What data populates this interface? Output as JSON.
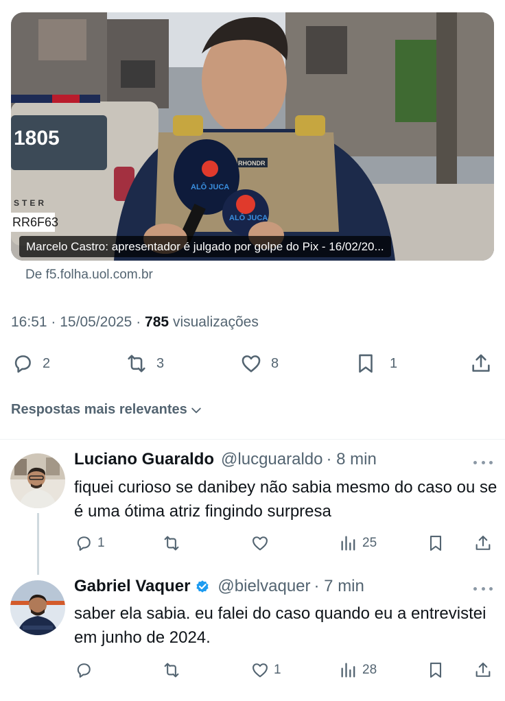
{
  "media": {
    "caption": "Marcelo Castro: apresentador é julgado por golpe do Pix - 16/02/20...",
    "vehicle_number": "1805",
    "vehicle_text": "STER",
    "plate": "RR6F63",
    "mic_label": "ALÔ JUCA",
    "vest_label": "RHONDR",
    "source": "De f5.folha.uol.com.br"
  },
  "tweet_meta": {
    "time": "16:51",
    "date": "15/05/2025",
    "sep": "·",
    "views_count": "785",
    "views_label": "visualizações"
  },
  "tweet_actions": {
    "replies": "2",
    "reposts": "3",
    "likes": "8",
    "bookmarks": "1"
  },
  "replies_header": {
    "label": "Respostas mais relevantes"
  },
  "replies": [
    {
      "name": "Luciano Guaraldo",
      "handle": "@lucguaraldo",
      "time": "· 8 min",
      "text": "fiquei curioso se danibey não sabia mesmo do caso ou se é uma ótima atriz fingindo surpresa",
      "reply_count": "1",
      "repost_count": "",
      "like_count": "",
      "view_count": "25"
    },
    {
      "name": "Gabriel Vaquer",
      "handle": "@bielvaquer",
      "time": "· 7 min",
      "text": "saber ela sabia. eu falei do caso quando eu a entrevistei em junho de 2024.",
      "reply_count": "",
      "repost_count": "",
      "like_count": "1",
      "view_count": "28"
    }
  ],
  "colors": {
    "text": "#0f1419",
    "secondary": "#536471",
    "verified": "#1d9bf0",
    "divider": "#eff3f4"
  }
}
